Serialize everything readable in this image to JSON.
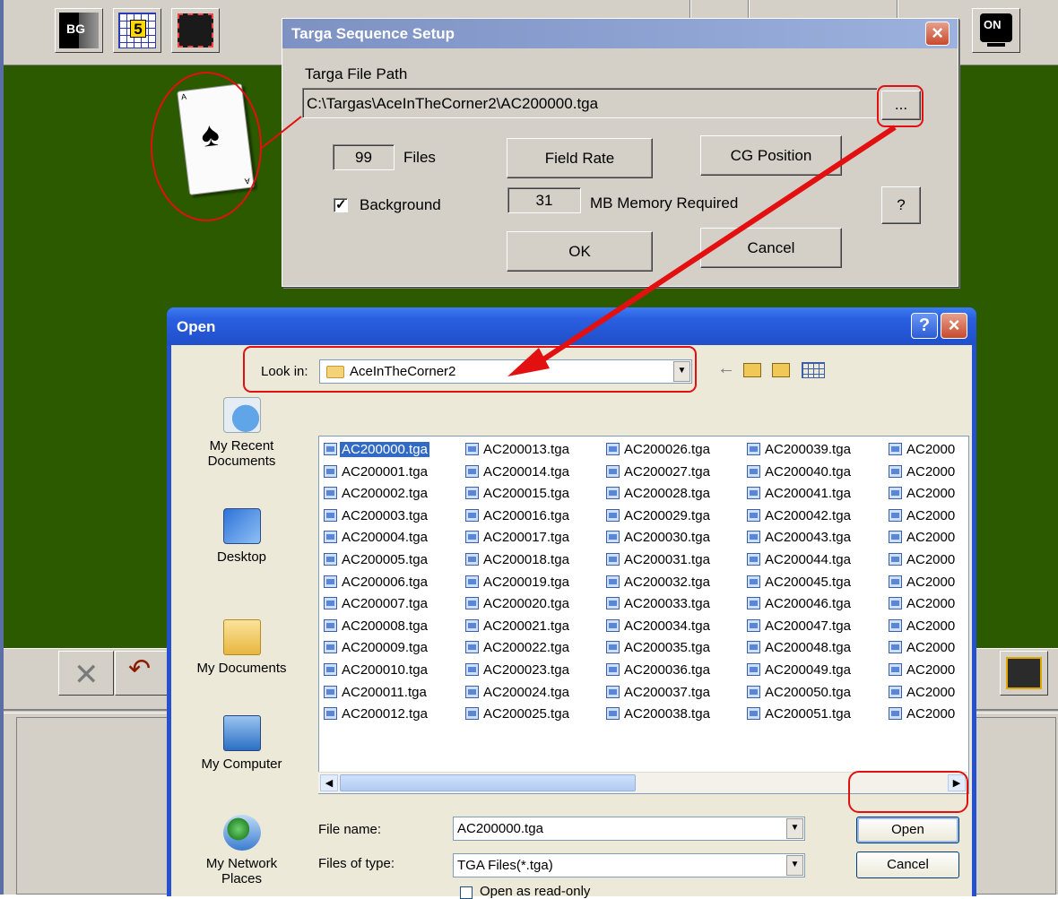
{
  "app": {
    "toolbar": {
      "bg_label": "BG",
      "count_label": "5",
      "on_label": "ON"
    }
  },
  "card": {
    "rank": "A",
    "suit": "♠"
  },
  "targa_dialog": {
    "title": "Targa Sequence Setup",
    "path_label": "Targa File Path",
    "path_value": "C:\\Targas\\AceInTheCorner2\\AC200000.tga",
    "browse_label": "...",
    "files_count": "99",
    "files_label": "Files",
    "field_rate_label": "Field Rate",
    "cg_position_label": "CG Position",
    "background_checked": true,
    "background_label": "Background",
    "memory_value": "31",
    "memory_label": "MB  Memory Required",
    "help_label": "?",
    "ok_label": "OK",
    "cancel_label": "Cancel"
  },
  "open_dialog": {
    "title": "Open",
    "look_in_label": "Look in:",
    "look_in_value": "AceInTheCorner2",
    "places": [
      {
        "label": "My Recent Documents",
        "icon": "recent-documents-icon"
      },
      {
        "label": "Desktop",
        "icon": "desktop-icon"
      },
      {
        "label": "My Documents",
        "icon": "my-documents-icon"
      },
      {
        "label": "My Computer",
        "icon": "my-computer-icon"
      },
      {
        "label": "My Network Places",
        "icon": "network-places-icon"
      }
    ],
    "files": {
      "col1": [
        "AC200000.tga",
        "AC200001.tga",
        "AC200002.tga",
        "AC200003.tga",
        "AC200004.tga",
        "AC200005.tga",
        "AC200006.tga",
        "AC200007.tga",
        "AC200008.tga",
        "AC200009.tga",
        "AC200010.tga",
        "AC200011.tga",
        "AC200012.tga"
      ],
      "col2": [
        "AC200013.tga",
        "AC200014.tga",
        "AC200015.tga",
        "AC200016.tga",
        "AC200017.tga",
        "AC200018.tga",
        "AC200019.tga",
        "AC200020.tga",
        "AC200021.tga",
        "AC200022.tga",
        "AC200023.tga",
        "AC200024.tga",
        "AC200025.tga"
      ],
      "col3": [
        "AC200026.tga",
        "AC200027.tga",
        "AC200028.tga",
        "AC200029.tga",
        "AC200030.tga",
        "AC200031.tga",
        "AC200032.tga",
        "AC200033.tga",
        "AC200034.tga",
        "AC200035.tga",
        "AC200036.tga",
        "AC200037.tga",
        "AC200038.tga"
      ],
      "col4": [
        "AC200039.tga",
        "AC200040.tga",
        "AC200041.tga",
        "AC200042.tga",
        "AC200043.tga",
        "AC200044.tga",
        "AC200045.tga",
        "AC200046.tga",
        "AC200047.tga",
        "AC200048.tga",
        "AC200049.tga",
        "AC200050.tga",
        "AC200051.tga"
      ],
      "col5": [
        "AC2000",
        "AC2000",
        "AC2000",
        "AC2000",
        "AC2000",
        "AC2000",
        "AC2000",
        "AC2000",
        "AC2000",
        "AC2000",
        "AC2000",
        "AC2000",
        "AC2000"
      ],
      "selected": "AC200000.tga"
    },
    "file_name_label": "File name:",
    "file_name_value": "AC200000.tga",
    "files_of_type_label": "Files of type:",
    "files_of_type_value": "TGA Files(*.tga)",
    "read_only_label": "Open as read-only",
    "read_only_checked": false,
    "open_label": "Open",
    "cancel_label": "Cancel"
  },
  "colors": {
    "canvas": "#2b5a00",
    "annotation": "#e21010",
    "xp_title": "#2a5fe0",
    "selection": "#316ac5"
  }
}
